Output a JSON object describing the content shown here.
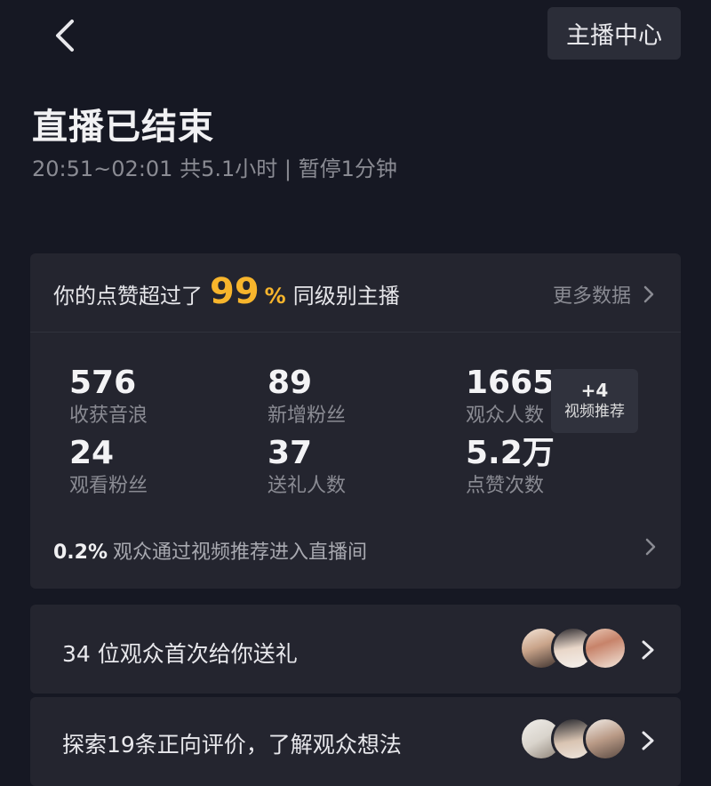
{
  "header": {
    "back_icon": "chevron-left-icon",
    "center_button": "主播中心"
  },
  "summary": {
    "title": "直播已结束",
    "subtitle": "20:51~02:01 共5.1小时 | 暂停1分钟"
  },
  "likes_card": {
    "prefix": "你的点赞超过了",
    "percent_number": "99",
    "percent_sign": "%",
    "suffix": "同级别主播",
    "more_link": "更多数据"
  },
  "stats": [
    {
      "value": "576",
      "label": "收获音浪"
    },
    {
      "value": "89",
      "label": "新增粉丝"
    },
    {
      "value": "1665",
      "label": "观众人数"
    },
    {
      "value": "24",
      "label": "观看粉丝"
    },
    {
      "value": "37",
      "label": "送礼人数"
    },
    {
      "value": "5.2万",
      "label": "点赞次数"
    }
  ],
  "video_badge": {
    "count": "+4",
    "label": "视频推荐"
  },
  "recommend": {
    "percent": "0.2%",
    "text": "观众通过视频推荐进入直播间"
  },
  "rows": [
    {
      "text": "34 位观众首次给你送礼"
    },
    {
      "text": "探索19条正向评价，了解观众想法"
    }
  ],
  "colors": {
    "background": "#161823",
    "card": "#24252f",
    "accent": "#f7b52c"
  }
}
